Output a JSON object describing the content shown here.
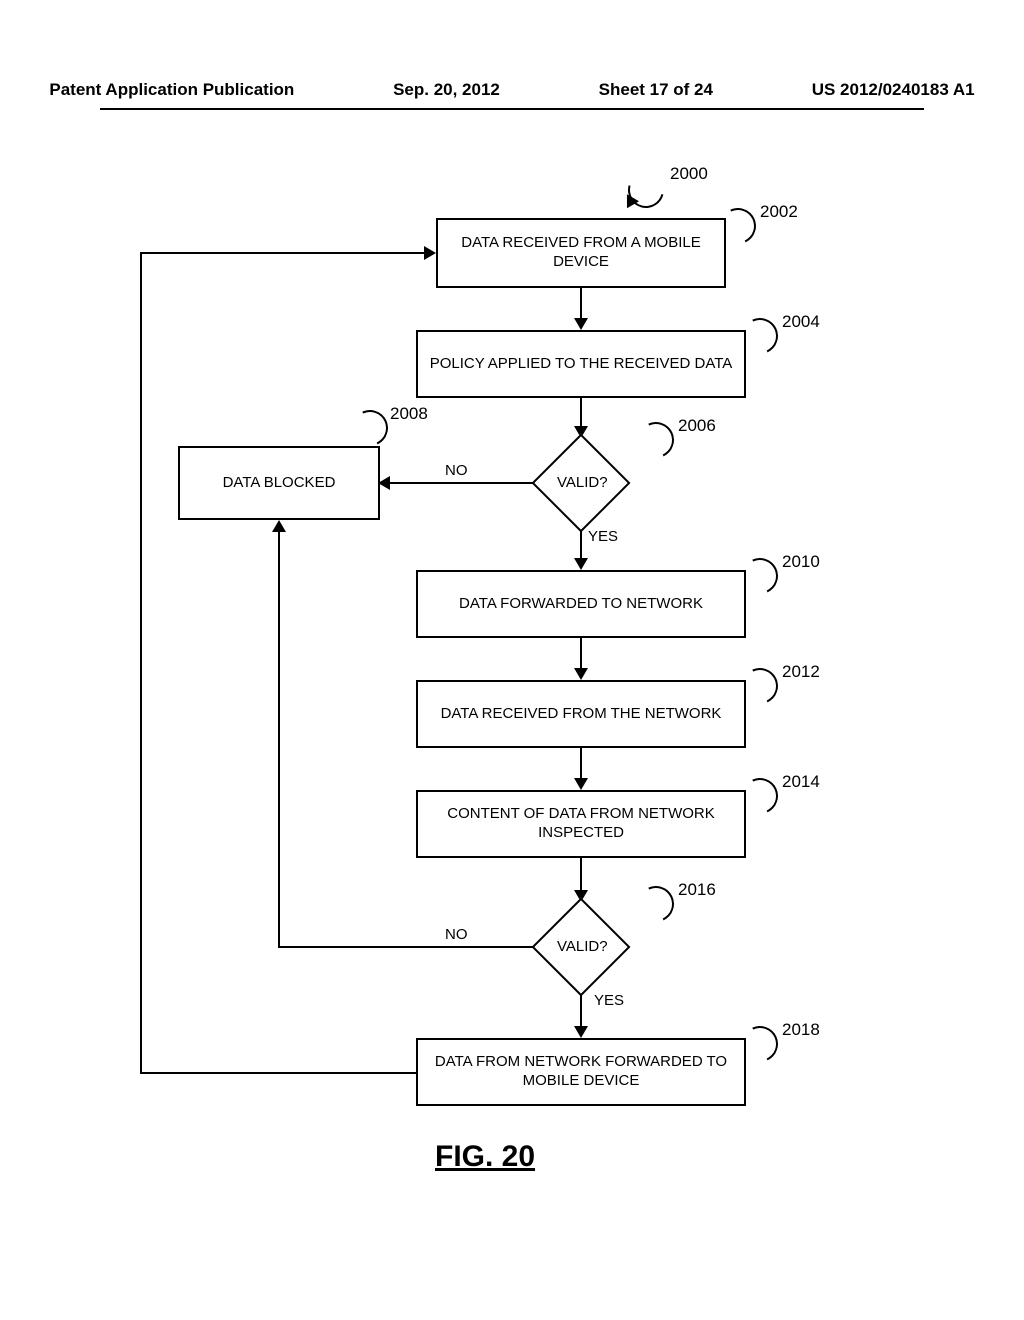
{
  "header": {
    "pub_type": "Patent Application Publication",
    "date": "Sep. 20, 2012",
    "sheet": "Sheet 17 of 24",
    "doc_num": "US 2012/0240183 A1"
  },
  "figure_label": "FIG. 20",
  "refs": {
    "r2000": "2000",
    "r2002": "2002",
    "r2004": "2004",
    "r2006": "2006",
    "r2008": "2008",
    "r2010": "2010",
    "r2012": "2012",
    "r2014": "2014",
    "r2016": "2016",
    "r2018": "2018"
  },
  "boxes": {
    "b2002": "DATA RECEIVED FROM A MOBILE DEVICE",
    "b2004": "POLICY APPLIED TO THE RECEIVED DATA",
    "b2008": "DATA BLOCKED",
    "b2010": "DATA FORWARDED TO NETWORK",
    "b2012": "DATA RECEIVED FROM THE NETWORK",
    "b2014": "CONTENT OF DATA FROM NETWORK INSPECTED",
    "b2018": "DATA FROM NETWORK FORWARDED TO MOBILE DEVICE"
  },
  "decisions": {
    "d2006": "VALID?",
    "d2016": "VALID?"
  },
  "labels": {
    "yes": "YES",
    "no": "NO"
  }
}
